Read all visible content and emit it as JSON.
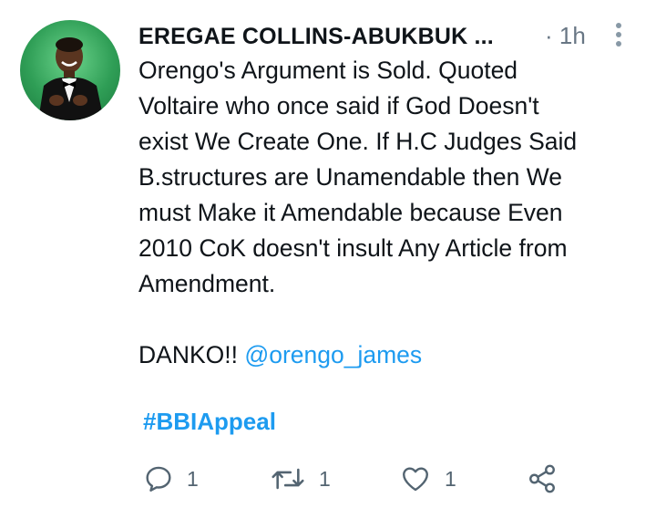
{
  "tweet": {
    "author_name": "EREGAE COLLINS-ABUKBUK ...",
    "time": "· 1h",
    "text_lines": [
      "Orengo's Argument is Sold. Quoted",
      "Voltaire who once said if God Doesn't",
      "exist We Create One. If H.C Judges Said",
      "B.structures are Unamendable then We",
      "must Make it Amendable because Even",
      "2010 CoK doesn't insult Any Article from",
      "Amendment."
    ],
    "closing_text": "DANKO!! ",
    "mention": "@orengo_james",
    "hashtag": "#BBIAppeal"
  },
  "actions": {
    "reply_count": "1",
    "retweet_count": "1",
    "like_count": "1"
  },
  "icons": [
    "avatar",
    "more-vertical-icon",
    "reply-icon",
    "retweet-icon",
    "like-icon",
    "share-icon"
  ],
  "colors": {
    "link": "#1d9bf0",
    "secondary": "#687684",
    "text": "#0f1419"
  }
}
